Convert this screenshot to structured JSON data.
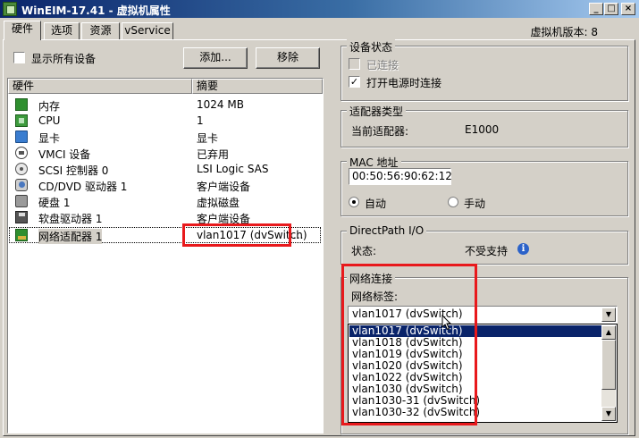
{
  "window": {
    "title": "WinEIM-17.41 - 虚拟机属性",
    "min_glyph": "_",
    "max_glyph": "□",
    "close_glyph": "×"
  },
  "tabs": [
    {
      "label": "硬件",
      "active": true
    },
    {
      "label": "选项",
      "active": false
    },
    {
      "label": "资源",
      "active": false
    },
    {
      "label": "vService",
      "active": false
    }
  ],
  "vm_version": "虚拟机版本: 8",
  "show_all_devices_label": "显示所有设备",
  "buttons": {
    "add": "添加...",
    "remove": "移除"
  },
  "hardware_table": {
    "columns": [
      "硬件",
      "摘要"
    ],
    "rows": [
      {
        "icon": "memory-icon",
        "name": "内存",
        "summary": "1024 MB"
      },
      {
        "icon": "cpu-icon",
        "name": "CPU",
        "summary": "1"
      },
      {
        "icon": "video-card-icon",
        "name": "显卡",
        "summary": "显卡"
      },
      {
        "icon": "vmci-device-icon",
        "name": "VMCI 设备",
        "summary": "已弃用"
      },
      {
        "icon": "scsi-controller-icon",
        "name": "SCSI 控制器 0",
        "summary": "LSI Logic SAS"
      },
      {
        "icon": "cd-dvd-drive-icon",
        "name": "CD/DVD 驱动器 1",
        "summary": "客户端设备"
      },
      {
        "icon": "hard-disk-icon",
        "name": "硬盘 1",
        "summary": "虚拟磁盘"
      },
      {
        "icon": "floppy-drive-icon",
        "name": "软盘驱动器 1",
        "summary": "客户端设备"
      },
      {
        "icon": "network-adapter-icon",
        "name": "网络适配器 1",
        "summary": "vlan1017 (dvSwitch)",
        "selected": true
      }
    ],
    "trailing_ellipsis": "..."
  },
  "device_status": {
    "title": "设备状态",
    "connected_label": "已连接",
    "connected_checked": false,
    "connected_enabled": false,
    "connect_at_power_on_label": "打开电源时连接",
    "connect_at_power_on_checked": true
  },
  "adapter_type": {
    "title": "适配器类型",
    "current_label": "当前适配器:",
    "current_value": "E1000"
  },
  "mac_address": {
    "title": "MAC 地址",
    "value": "00:50:56:90:62:12",
    "auto_label": "自动",
    "manual_label": "手动",
    "selected": "auto"
  },
  "directpath": {
    "title": "DirectPath I/O",
    "status_label": "状态:",
    "status_value": "不受支持"
  },
  "network_connection": {
    "title": "网络连接",
    "label_caption": "网络标签:",
    "selected_value": "vlan1017 (dvSwitch)",
    "options": [
      "vlan1017 (dvSwitch)",
      "vlan1018 (dvSwitch)",
      "vlan1019 (dvSwitch)",
      "vlan1020 (dvSwitch)",
      "vlan1022 (dvSwitch)",
      "vlan1030 (dvSwitch)",
      "vlan1030-31 (dvSwitch)",
      "vlan1030-32 (dvSwitch)"
    ],
    "highlighted_index": 0
  },
  "glyphs": {
    "checkmark": "✓",
    "down_arrow": "▼",
    "up_arrow": "▲",
    "info": "i"
  },
  "colors": {
    "highlight": "#0a246a",
    "annotation_red": "#e8191c",
    "titlebar": "#0a246a"
  }
}
